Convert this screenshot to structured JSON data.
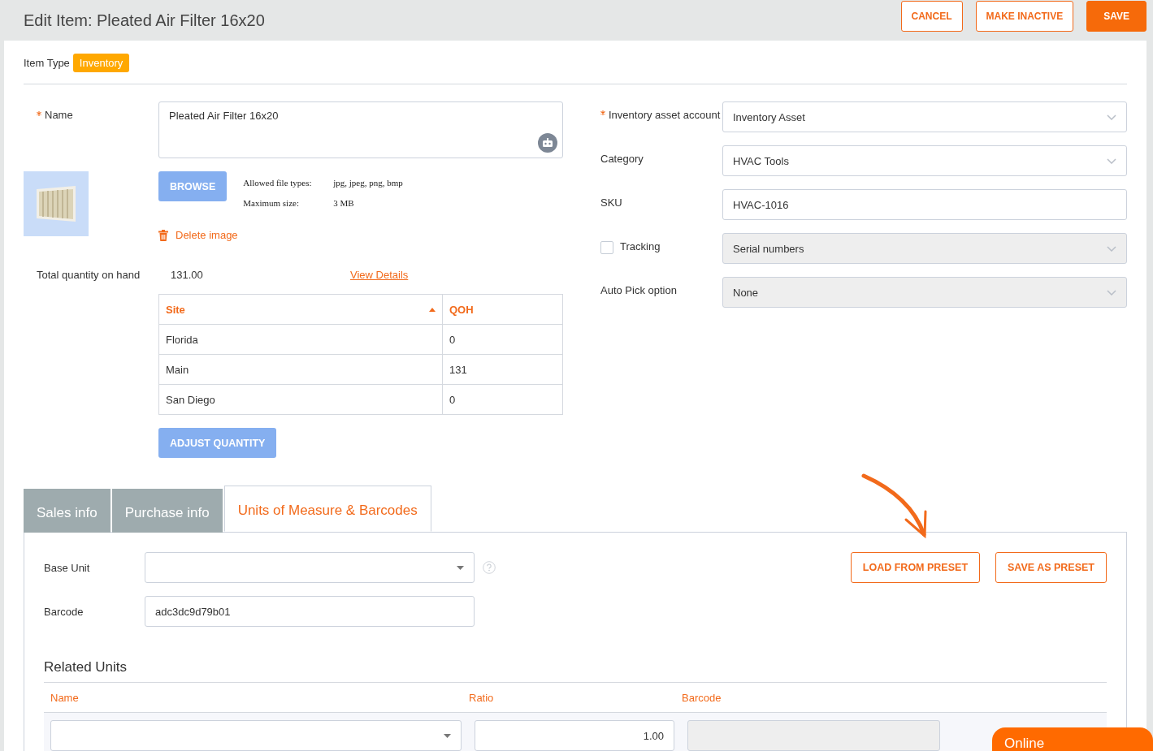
{
  "header": {
    "title": "Edit Item: Pleated Air Filter 16x20",
    "buttons": [
      {
        "label": "CANCEL",
        "kind": "outline"
      },
      {
        "label": "MAKE INACTIVE",
        "kind": "outline"
      },
      {
        "label": "SAVE",
        "kind": "primary"
      }
    ]
  },
  "item_type": {
    "label": "Item Type",
    "value": "Inventory"
  },
  "name_field": {
    "label": "Name",
    "required": true,
    "value": "Pleated Air Filter 16x20"
  },
  "image": {
    "browse": "BROWSE",
    "info": [
      {
        "label": "Allowed file types:",
        "value": "jpg, jpeg, png, bmp"
      },
      {
        "label": "Maximum size:",
        "value": "3 MB"
      }
    ],
    "delete": "Delete image"
  },
  "quantity": {
    "label": "Total quantity on hand",
    "value": "131.00",
    "link": "View Details"
  },
  "sites_table": {
    "columns": [
      "Site",
      "QOH"
    ],
    "rows": [
      [
        "Florida",
        "0"
      ],
      [
        "Main",
        "131"
      ],
      [
        "San Diego",
        "0"
      ]
    ]
  },
  "adjust_button": "ADJUST QUANTITY",
  "right_fields": [
    {
      "kind": "select",
      "label": "Inventory asset account",
      "required": true,
      "value": "Inventory Asset",
      "disabled": false
    },
    {
      "kind": "select",
      "label": "Category",
      "required": false,
      "value": "HVAC Tools",
      "disabled": false
    },
    {
      "kind": "text",
      "label": "SKU",
      "required": false,
      "value": "HVAC-1016",
      "disabled": false
    },
    {
      "kind": "checkbox",
      "label": "Tracking",
      "required": false,
      "checked": false,
      "value": "Serial numbers",
      "disabled": true
    },
    {
      "kind": "select",
      "label": "Auto Pick option",
      "required": false,
      "value": "None",
      "disabled": true
    }
  ],
  "tabs": [
    {
      "label": "Sales info",
      "selected": false
    },
    {
      "label": "Purchase info",
      "selected": false
    },
    {
      "label": "Units of Measure & Barcodes",
      "selected": true
    }
  ],
  "units": {
    "base_unit_label": "Base Unit",
    "barcode_label": "Barcode",
    "barcode_value": "adc3dc9d79b01",
    "preset_buttons": [
      "LOAD FROM PRESET",
      "SAVE AS PRESET"
    ],
    "related_title": "Related Units",
    "columns": [
      "Name",
      "Ratio",
      "Barcode"
    ],
    "rows": [
      {
        "ratio": "1.00"
      }
    ]
  },
  "chat": {
    "label": "Online"
  }
}
